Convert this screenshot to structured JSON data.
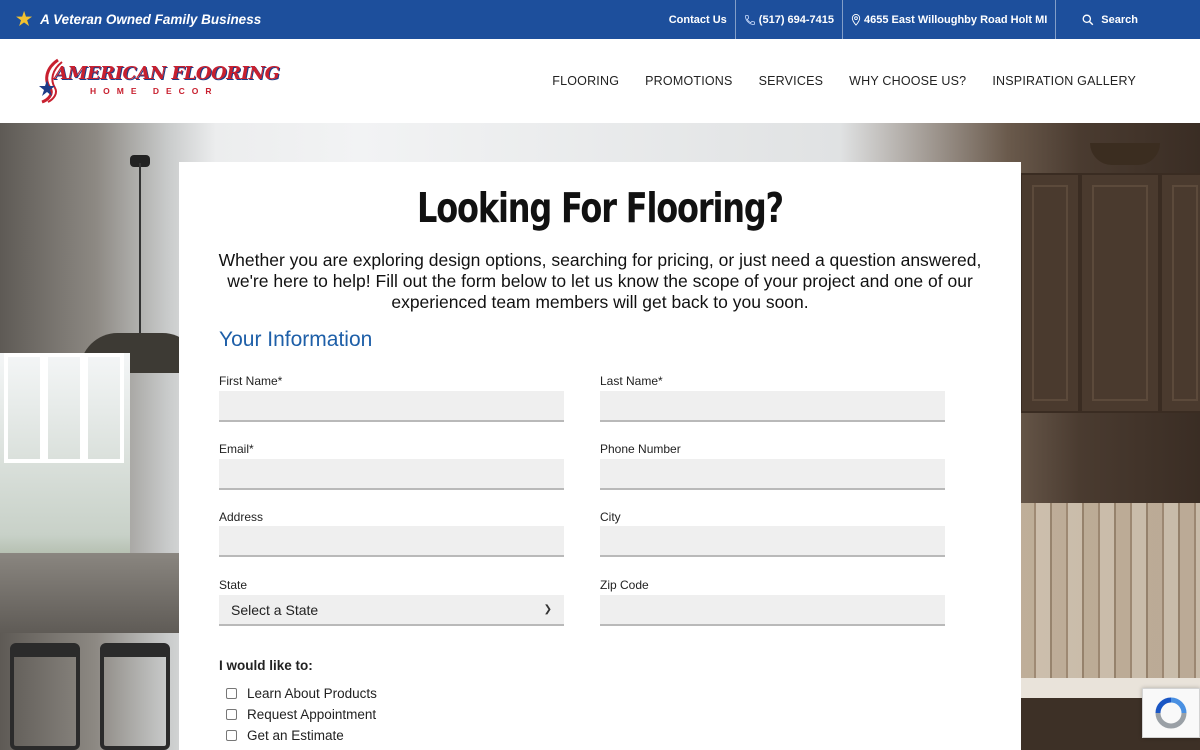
{
  "topbar": {
    "tagline": "A Veteran Owned Family Business",
    "contact_label": "Contact Us",
    "phone": "(517) 694-7415",
    "address": "4655 East Willoughby Road Holt MI",
    "search_label": "Search"
  },
  "logo": {
    "brand": "AMERICAN FLOORING",
    "sub": "HOME DECOR"
  },
  "nav": {
    "items": [
      "FLOORING",
      "PROMOTIONS",
      "SERVICES",
      "WHY CHOOSE US?",
      "INSPIRATION GALLERY"
    ]
  },
  "form": {
    "title": "Looking For Flooring?",
    "intro": "Whether you are exploring design options, searching for pricing, or just need a question answered, we're here to help! Fill out the form below to let us know the scope of your project and one of our experienced team members will get back to you soon.",
    "section_title": "Your Information",
    "labels": {
      "first_name": "First Name*",
      "last_name": "Last Name*",
      "email": "Email*",
      "phone": "Phone Number",
      "address": "Address",
      "city": "City",
      "state": "State",
      "zip": "Zip Code"
    },
    "values": {
      "first_name": "",
      "last_name": "",
      "email": "",
      "phone": "",
      "address": "",
      "city": "",
      "zip": ""
    },
    "state_selected": "Select a State",
    "checks_title": "I would like to:",
    "checks": [
      "Learn About Products",
      "Request Appointment",
      "Get an Estimate"
    ]
  },
  "colors": {
    "topbar": "#1d4f9c",
    "accent_blue": "#1e5fa8",
    "brand_red": "#c8202f",
    "star": "#f2c230"
  },
  "icons": {
    "star": "star-icon",
    "phone": "phone-icon",
    "location": "map-pin-icon",
    "search": "search-icon",
    "recaptcha": "recaptcha-icon"
  }
}
